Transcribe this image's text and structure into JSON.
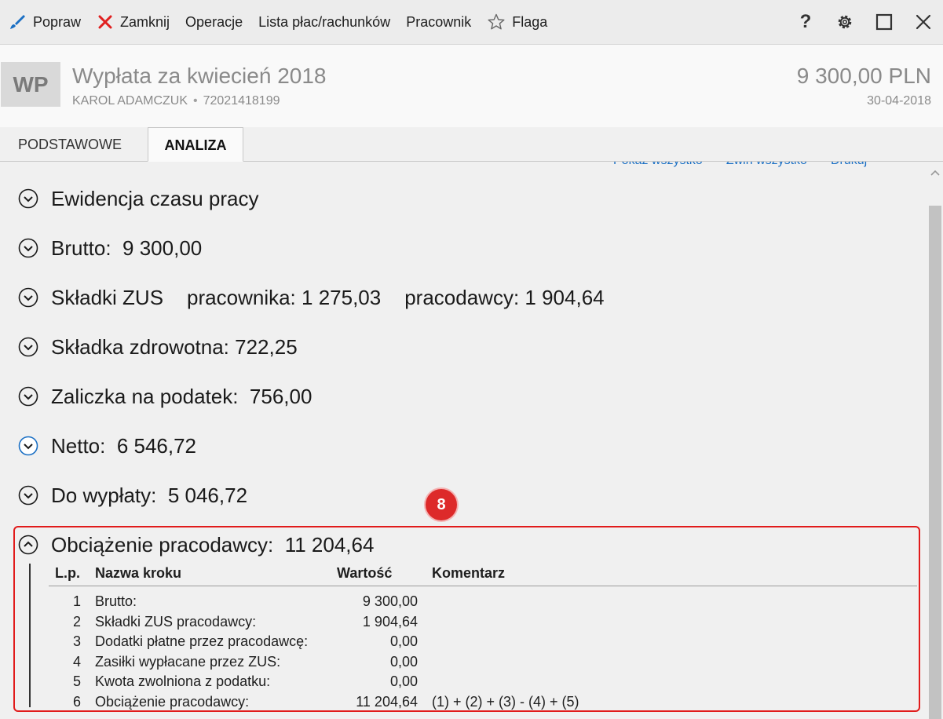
{
  "toolbar": {
    "edit": "Popraw",
    "close": "Zamknij",
    "operations": "Operacje",
    "payroll_list": "Lista płac/rachunków",
    "employee": "Pracownik",
    "flag": "Flaga",
    "help": "?"
  },
  "header": {
    "avatar": "WP",
    "title": "Wypłata za kwiecień 2018",
    "employee_name": "KAROL ADAMCZUK",
    "separator": "•",
    "employee_id": "72021418199",
    "amount": "9 300,00 PLN",
    "date": "30-04-2018"
  },
  "tabs": {
    "basic": "PODSTAWOWE",
    "analysis": "ANALIZA"
  },
  "actions": {
    "show_all": "Pokaż wszystko",
    "collapse_all": "Zwiń wszystko",
    "print": "Drukuj"
  },
  "sections": {
    "time": "Ewidencja czasu pracy",
    "gross": "Brutto:  9 300,00",
    "zus_label": "Składki ZUS",
    "zus_employee": "pracownika: 1 275,03",
    "zus_employer": "pracodawcy: 1 904,64",
    "health": "Składka zdrowotna: 722,25",
    "tax": "Zaliczka na podatek:  756,00",
    "net": "Netto:  6 546,72",
    "payout": "Do wypłaty:  5 046,72",
    "employer_cost": "Obciążenie pracodawcy:  11 204,64"
  },
  "badge": "8",
  "table": {
    "headers": {
      "lp": "L.p.",
      "name": "Nazwa kroku",
      "value": "Wartość",
      "comment": "Komentarz"
    },
    "rows": [
      {
        "lp": "1",
        "name": "Brutto:",
        "value": "9 300,00",
        "comment": ""
      },
      {
        "lp": "2",
        "name": "Składki ZUS pracodawcy:",
        "value": "1 904,64",
        "comment": ""
      },
      {
        "lp": "3",
        "name": "Dodatki płatne przez pracodawcę:",
        "value": "0,00",
        "comment": ""
      },
      {
        "lp": "4",
        "name": "Zasiłki wypłacane przez ZUS:",
        "value": "0,00",
        "comment": ""
      },
      {
        "lp": "5",
        "name": "Kwota zwolniona z podatku:",
        "value": "0,00",
        "comment": ""
      },
      {
        "lp": "6",
        "name": "Obciążenie pracodawcy:",
        "value": "11 204,64",
        "comment": "(1) + (2) + (3) - (4) + (5)"
      }
    ]
  },
  "colors": {
    "accent_blue": "#1a6fc4",
    "highlight_red": "#e11b1b",
    "close_red": "#e02020"
  }
}
